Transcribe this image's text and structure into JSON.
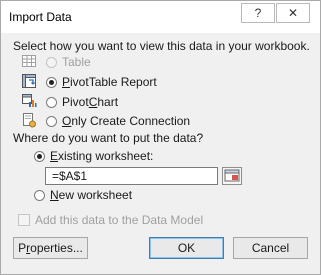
{
  "window": {
    "title": "Import Data",
    "help_label": "?",
    "close_label": "✕"
  },
  "view": {
    "heading": "Select how you want to view this data in your workbook.",
    "options": [
      {
        "label": "Table",
        "selected": false,
        "enabled": false
      },
      {
        "label": "PivotTable Report",
        "selected": true,
        "enabled": true
      },
      {
        "label": "PivotChart",
        "selected": false,
        "enabled": true
      },
      {
        "label": "Only Create Connection",
        "selected": false,
        "enabled": true
      }
    ]
  },
  "destination": {
    "heading": "Where do you want to put the data?",
    "existing_label": "Existing worksheet:",
    "existing_selected": true,
    "cell_value": "=$A$1",
    "new_label": "New worksheet",
    "new_selected": false
  },
  "data_model": {
    "label": "Add this data to the Data Model",
    "checked": false,
    "enabled": false
  },
  "buttons": {
    "properties": "Properties...",
    "ok": "OK",
    "cancel": "Cancel"
  },
  "colors": {
    "icon_blue": "#2e6fb5",
    "icon_orange": "#e87722",
    "close_red": "#c42b1c",
    "default_button_border": "#3c7fb1"
  }
}
